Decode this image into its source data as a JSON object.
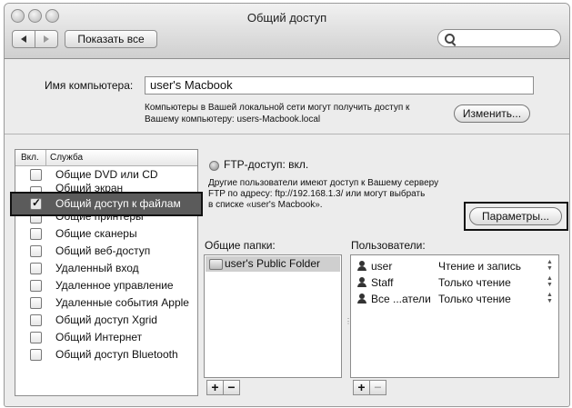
{
  "window": {
    "title": "Общий доступ"
  },
  "toolbar": {
    "show_all_label": "Показать все"
  },
  "computer": {
    "name_label": "Имя компьютера:",
    "name_value": "user's Macbook",
    "note_line1": "Компьютеры в Вашей локальной сети могут получить доступ к",
    "note_line2": "Вашему компьютеру: users-Macbook.local",
    "change_label": "Изменить..."
  },
  "services": {
    "header_on": "Вкл.",
    "header_service": "Служба",
    "items": [
      {
        "label": "Общие DVD или CD",
        "checked": false
      },
      {
        "label": "Общий экран",
        "checked": false
      },
      {
        "label": "Общий доступ к файлам",
        "checked": true,
        "selected": true
      },
      {
        "label": "Общие принтеры",
        "checked": false
      },
      {
        "label": "Общие сканеры",
        "checked": false
      },
      {
        "label": "Общий веб-доступ",
        "checked": false
      },
      {
        "label": "Удаленный вход",
        "checked": false
      },
      {
        "label": "Удаленное управление",
        "checked": false
      },
      {
        "label": "Удаленные события Apple",
        "checked": false
      },
      {
        "label": "Общий доступ Xgrid",
        "checked": false
      },
      {
        "label": "Общий Интернет",
        "checked": false
      },
      {
        "label": "Общий доступ Bluetooth",
        "checked": false
      }
    ]
  },
  "ftp": {
    "status": "FTP-доступ: вкл.",
    "desc_line1": "Другие пользователи имеют доступ к Вашему серверу",
    "desc_line2": "FTP по адресу: ftp://192.168.1.3/ или могут выбрать",
    "desc_line3": "в списке «user's Macbook».",
    "params_label": "Параметры..."
  },
  "shared_folders": {
    "header": "Общие папки:",
    "items": [
      "user's Public Folder"
    ]
  },
  "users": {
    "header": "Пользователи:",
    "items": [
      {
        "name": "user",
        "permission": "Чтение и запись"
      },
      {
        "name": "Staff",
        "permission": "Только чтение"
      },
      {
        "name": "Все ...атели",
        "permission": "Только чтение"
      }
    ]
  },
  "buttons": {
    "add": "+",
    "remove": "−"
  }
}
